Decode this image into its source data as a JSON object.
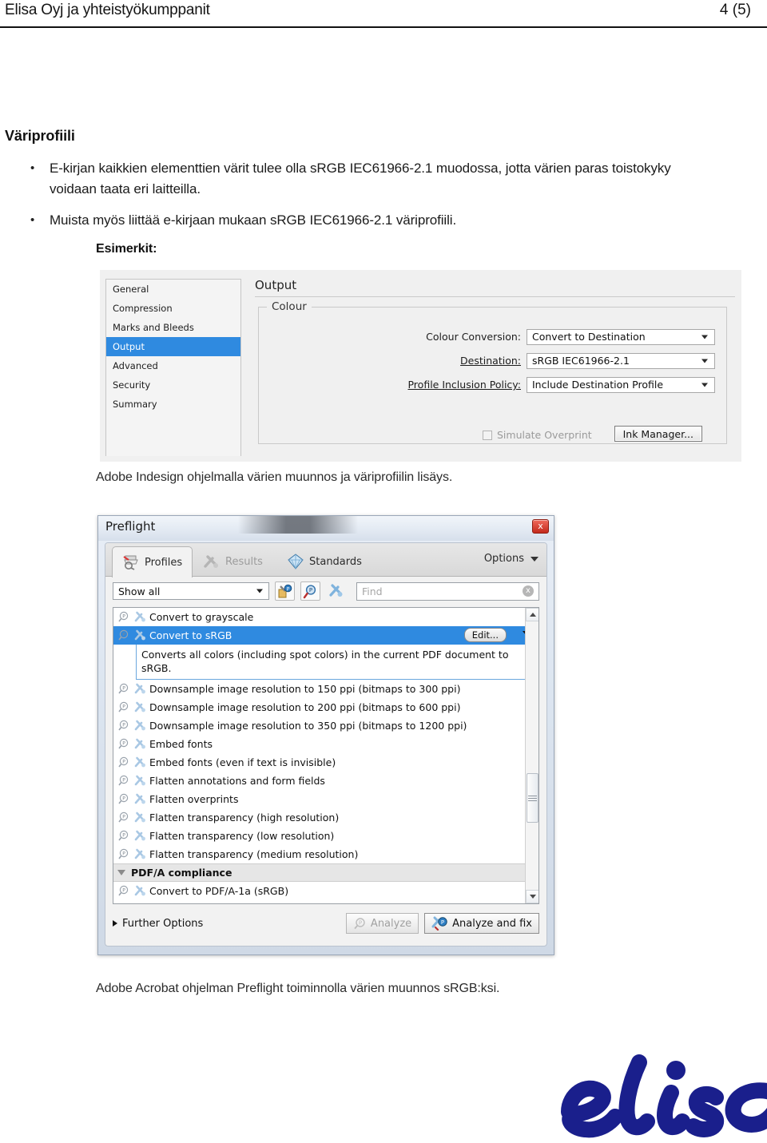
{
  "header": {
    "company": "Elisa Oyj ja yhteistyökumppanit",
    "page": "4 (5)"
  },
  "section": {
    "title": "Väriprofiili",
    "bullets": [
      "E-kirjan kaikkien elementtien värit tulee olla sRGB IEC61966-2.1 muodossa, jotta värien paras toistokyky voidaan taata eri laitteilla.",
      "Muista myös liittää e-kirjaan mukaan sRGB IEC61966-2.1 väriprofiili."
    ],
    "examples_label": "Esimerkit:"
  },
  "indesign": {
    "nav": [
      "General",
      "Compression",
      "Marks and Bleeds",
      "Output",
      "Advanced",
      "Security",
      "Summary"
    ],
    "selected_nav": "Output",
    "heading": "Output",
    "group_label": "Colour",
    "fields": [
      {
        "label": "Colour Conversion:",
        "value": "Convert to Destination"
      },
      {
        "label": "Destination:",
        "value": "sRGB IEC61966-2.1"
      },
      {
        "label": "Profile Inclusion Policy:",
        "value": "Include Destination Profile"
      }
    ],
    "checkbox_label": "Simulate Overprint",
    "button_label": "Ink Manager..."
  },
  "caption1": "Adobe Indesign ohjelmalla värien muunnos ja väriprofiilin lisäys.",
  "preflight": {
    "title": "Preflight",
    "close_label": "x",
    "tabs": [
      {
        "label": "Profiles",
        "icon": "preflight-profiles-icon",
        "state": "active"
      },
      {
        "label": "Results",
        "icon": "results-wrench-icon",
        "state": "disabled"
      },
      {
        "label": "Standards",
        "icon": "standards-diamond-icon",
        "state": "normal"
      }
    ],
    "options_label": "Options",
    "filter_value": "Show all",
    "toolbar_icons": [
      "new-profile-icon",
      "search-profile-icon",
      "wrench-icon"
    ],
    "find_placeholder": "Find",
    "find_clear_label": "x",
    "list": [
      {
        "label": "Convert to grayscale",
        "type": "item"
      },
      {
        "label": "Convert to sRGB",
        "type": "item",
        "selected": true,
        "edit_label": "Edit...",
        "description": "Converts all colors (including spot colors) in the current PDF document to sRGB."
      },
      {
        "label": "Downsample image resolution to 150 ppi (bitmaps to 300 ppi)",
        "type": "item"
      },
      {
        "label": "Downsample image resolution to 200 ppi (bitmaps to 600 ppi)",
        "type": "item"
      },
      {
        "label": "Downsample image resolution to 350 ppi (bitmaps to 1200 ppi)",
        "type": "item"
      },
      {
        "label": "Embed fonts",
        "type": "item"
      },
      {
        "label": "Embed fonts (even if text is invisible)",
        "type": "item"
      },
      {
        "label": "Flatten annotations and form fields",
        "type": "item"
      },
      {
        "label": "Flatten overprints",
        "type": "item"
      },
      {
        "label": "Flatten transparency (high resolution)",
        "type": "item"
      },
      {
        "label": "Flatten transparency (low resolution)",
        "type": "item"
      },
      {
        "label": "Flatten transparency (medium resolution)",
        "type": "item"
      },
      {
        "label": "PDF/A compliance",
        "type": "group"
      },
      {
        "label": "Convert to PDF/A-1a (sRGB)",
        "type": "item"
      }
    ],
    "further_options_label": "Further Options",
    "analyze_label": "Analyze",
    "analyze_fix_label": "Analyze and fix"
  },
  "caption2": "Adobe Acrobat ohjelman Preflight toiminnolla värien muunnos sRGB:ksi.",
  "logo": {
    "name": "elisa",
    "color": "#1a1f8c"
  },
  "colors": {
    "selection_blue": "#2f8ae0",
    "rule": "#111111",
    "brand_blue": "#1a1f8c"
  }
}
